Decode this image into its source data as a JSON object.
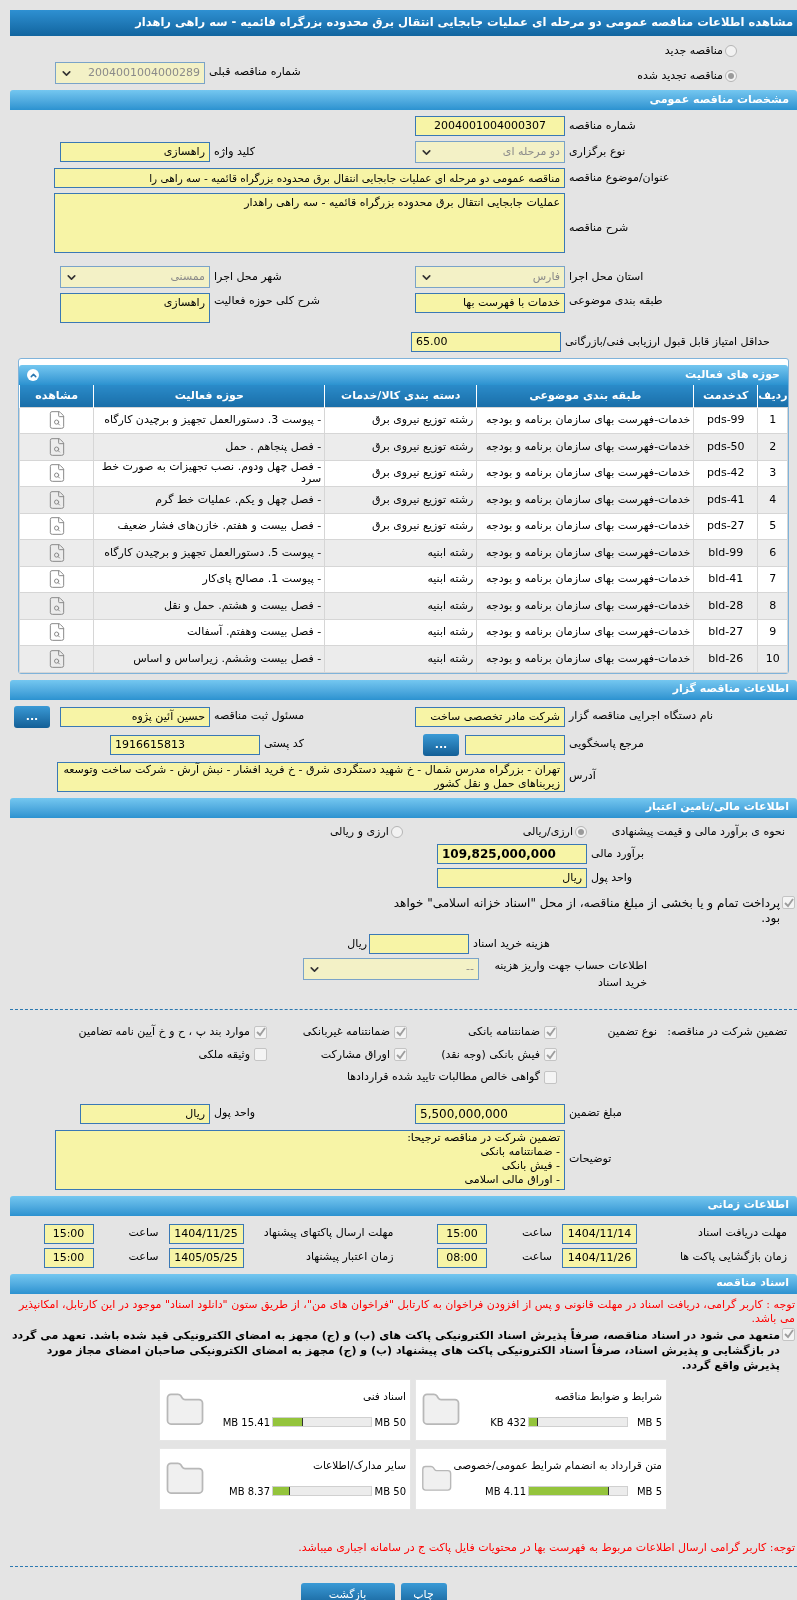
{
  "title": "مشاهده اطلاعات مناقصه عمومی دو مرحله ای عملیات جابجایی انتقال برق محدوده بزرگراه قائمیه - سه راهی راهدار",
  "tender_type": [
    {
      "label": "مناقصه جدید",
      "selected": false
    },
    {
      "label": "مناقصه تجدید شده",
      "selected": true
    }
  ],
  "previous_tender": {
    "label": "شماره مناقصه قبلی",
    "value": "2004001004000289"
  },
  "general": {
    "heading": "مشخصات مناقصه عمومی",
    "number": {
      "label": "شماره مناقصه",
      "value": "2004001004000307"
    },
    "holding_type": {
      "label": "نوع برگزاری",
      "value": "دو مرحله ای"
    },
    "keyword": {
      "label": "کلید واژه",
      "value": "راهسازی"
    },
    "subject": {
      "label": "عنوان/موضوع مناقصه",
      "value": "مناقصه عمومی دو مرحله ای عملیات جابجایی انتقال برق محدوده بزرگراه قائمیه - سه راهی را"
    },
    "description": {
      "label": "شرح مناقصه",
      "value": "عملیات جابجایی انتقال برق محدوده بزرگراه قائمیه - سه راهی راهدار"
    },
    "province": {
      "label": "استان محل اجرا",
      "value": "فارس"
    },
    "city": {
      "label": "شهر محل اجرا",
      "value": "ممسنی"
    },
    "category": {
      "label": "طبقه بندی موضوعی",
      "value": "خدمات با فهرست بها"
    },
    "activity_scope": {
      "label": "شرح کلی حوزه فعالیت",
      "value": "راهسازی"
    },
    "min_score": {
      "label": "حداقل امتیاز قابل قبول ارزیابی فنی/بازرگانی",
      "value": "65.00"
    }
  },
  "activities": {
    "heading": "حوزه های فعالیت",
    "columns": [
      "ردیف",
      "کدخدمت",
      "طبقه بندی موضوعی",
      "دسته بندی کالا/خدمات",
      "حوزه فعالیت",
      "مشاهده"
    ],
    "rows": [
      [
        "1",
        "pds-99",
        "خدمات-فهرست بهای سازمان برنامه و بودجه",
        "رشته توزیع نیروی برق",
        "- پیوست 3. دستورالعمل تجهیز و برچیدن کارگاه"
      ],
      [
        "2",
        "pds-50",
        "خدمات-فهرست بهای سازمان برنامه و بودجه",
        "رشته توزیع نیروی برق",
        "- فصل پنجاهم . حمل"
      ],
      [
        "3",
        "pds-42",
        "خدمات-فهرست بهای سازمان برنامه و بودجه",
        "رشته توزیع نیروی برق",
        "- فصل چهل ودوم. نصب تجهیزات به صورت خط سرد"
      ],
      [
        "4",
        "pds-41",
        "خدمات-فهرست بهای سازمان برنامه و بودجه",
        "رشته توزیع نیروی برق",
        "- فصل چهل و یکم. عملیات خط گرم"
      ],
      [
        "5",
        "pds-27",
        "خدمات-فهرست بهای سازمان برنامه و بودجه",
        "رشته توزیع نیروی برق",
        "- فصل بیست و هفتم. خازن‌های فشار ضعیف"
      ],
      [
        "6",
        "bld-99",
        "خدمات-فهرست بهای سازمان برنامه و بودجه",
        "رشته ابنیه",
        "- پیوست 5. دستورالعمل تجهیز و برچیدن کارگاه"
      ],
      [
        "7",
        "bld-41",
        "خدمات-فهرست بهای سازمان برنامه و بودجه",
        "رشته ابنیه",
        "- پیوست 1. مصالح پای‌کار"
      ],
      [
        "8",
        "bld-28",
        "خدمات-فهرست بهای سازمان برنامه و بودجه",
        "رشته ابنیه",
        "- فصل بیست و هشتم. حمل و نقل"
      ],
      [
        "9",
        "bld-27",
        "خدمات-فهرست بهای سازمان برنامه و بودجه",
        "رشته ابنیه",
        "- فصل بیست وهفتم. آسفالت"
      ],
      [
        "10",
        "bld-26",
        "خدمات-فهرست بهای سازمان برنامه و بودجه",
        "رشته ابنیه",
        "- فصل بیست وششم. زیراساس و اساس"
      ]
    ]
  },
  "organizer": {
    "heading": "اطلاعات مناقصه گزار",
    "org_name": {
      "label": "نام دستگاه اجرایی مناقصه گزار",
      "value": "شرکت مادر تخصصی ساخت"
    },
    "registrar": {
      "label": "مسئول ثبت مناقصه",
      "value": "حسین آئین پژوه",
      "button": "..."
    },
    "reference": {
      "label": "مرجع پاسخگویی",
      "button": "..."
    },
    "postal_code": {
      "label": "کد پستی",
      "value": "1916615813"
    },
    "address": {
      "label": "آدرس",
      "value": "تهران - بزرگراه مدرس شمال - خ شهید دستگردی شرق -  خ فرید افشار - نبش آرش - شرکت ساخت وتوسعه زیربناهای حمل و نقل کشور"
    }
  },
  "financial": {
    "heading": "اطلاعات مالی/تامین اعتبار",
    "method": {
      "label": "نحوه ی برآورد مالی و قیمت پیشنهادی",
      "options": [
        {
          "label": "ارزی/ریالی",
          "selected": true
        },
        {
          "label": "ارزی و ریالی",
          "selected": false
        }
      ]
    },
    "estimate": {
      "label": "برآورد مالی",
      "value": "109,825,000,000"
    },
    "currency": {
      "label": "واحد پول",
      "value": "ریال"
    },
    "treasury": {
      "checked": true,
      "text": "پرداخت تمام و یا بخشی از مبلغ مناقصه، از محل \"اسناد خزانه اسلامی\" خواهد بود."
    },
    "doc_fee": {
      "label": "هزینه خرید اسناد",
      "unit": "ریال"
    },
    "account": {
      "label": "اطلاعات حساب جهت واریز هزینه خرید اسناد",
      "value": "--"
    }
  },
  "guarantee": {
    "label": "تضمین شرکت در مناقصه:",
    "type_label": "نوع تضمین",
    "options": [
      {
        "label": "ضمانتنامه بانکی",
        "checked": true
      },
      {
        "label": "ضمانتنامه غیربانکی",
        "checked": true
      },
      {
        "label": "موارد بند پ ، ح و خ آیین نامه تضامین",
        "checked": true
      },
      {
        "label": "فیش بانکی (وجه نقد)",
        "checked": true
      },
      {
        "label": "اوراق مشارکت",
        "checked": true
      },
      {
        "label": "وثیقه ملکی",
        "checked": false
      },
      {
        "label": "گواهی خالص مطالبات تایید شده قراردادها",
        "checked": false
      }
    ],
    "amount": {
      "label": "مبلغ تضمین",
      "value": "5,500,000,000"
    },
    "currency": {
      "label": "واحد پول",
      "value": "ریال"
    },
    "notes": {
      "label": "توضیحات",
      "lines": [
        "تضمین شرکت در مناقصه ترجیحا:",
        "- ضمانتنامه بانکی",
        "- فیش بانکی",
        "- اوراق مالی اسلامی"
      ]
    }
  },
  "timing": {
    "heading": "اطلاعات زمانی",
    "items": [
      {
        "label": "مهلت دریافت اسناد",
        "date": "1404/11/14",
        "time_label": "ساعت",
        "time": "15:00"
      },
      {
        "label": "مهلت ارسال پاکتهای پیشنهاد",
        "date": "1404/11/25",
        "time_label": "ساعت",
        "time": "15:00"
      },
      {
        "label": "زمان بازگشایی پاکت ها",
        "date": "1404/11/26",
        "time_label": "ساعت",
        "time": "08:00"
      },
      {
        "label": "زمان اعتبار پیشنهاد",
        "date": "1405/05/25",
        "time_label": "ساعت",
        "time": "15:00"
      }
    ]
  },
  "documents": {
    "heading": "اسناد مناقصه",
    "notice": "توجه : کاربر گرامی، دریافت اسناد در مهلت قانونی و پس از افزودن فراخوان به کارتابل \"فراخوان های من\"، از طریق ستون \"دانلود اسناد\" موجود در این کارتابل، امکانپذیر می باشد.",
    "commitment": {
      "checked": true,
      "text": "متعهد می شود در اسناد مناقصه، صرفاً پذیرش اسناد الکترونیکی پاکت های (ب) و (ج) مجهز به امضای الکترونیکی قید شده باشد. تعهد می گردد در بازگشایی و پذیرش اسناد، صرفاً اسناد الکترونیکی پاکت های پیشنهاد (ب) و (ج) مجهز به امضای الکترونیکی صاحبان امضای مجاز مورد پذیرش واقع گردد."
    },
    "files": [
      {
        "name": "شرایط و ضوابط مناقصه",
        "max": "5 MB",
        "size": "432 KB",
        "level": 0.09
      },
      {
        "name": "اسناد فنی",
        "max": "50 MB",
        "size": "15.41 MB",
        "level": 0.31
      },
      {
        "name": "متن قرارداد به انضمام شرایط عمومی/خصوصی",
        "max": "5 MB",
        "size": "4.11 MB",
        "level": 0.82
      },
      {
        "name": "سایر مدارک/اطلاعات",
        "max": "50 MB",
        "size": "8.37 MB",
        "level": 0.17
      }
    ],
    "footer_notice": "توجه: کاربر گرامی ارسال اطلاعات مربوط به فهرست بها در محتویات فایل پاکت ج در سامانه اجباری میباشد."
  },
  "buttons": [
    "چاپ",
    "بازگشت"
  ]
}
